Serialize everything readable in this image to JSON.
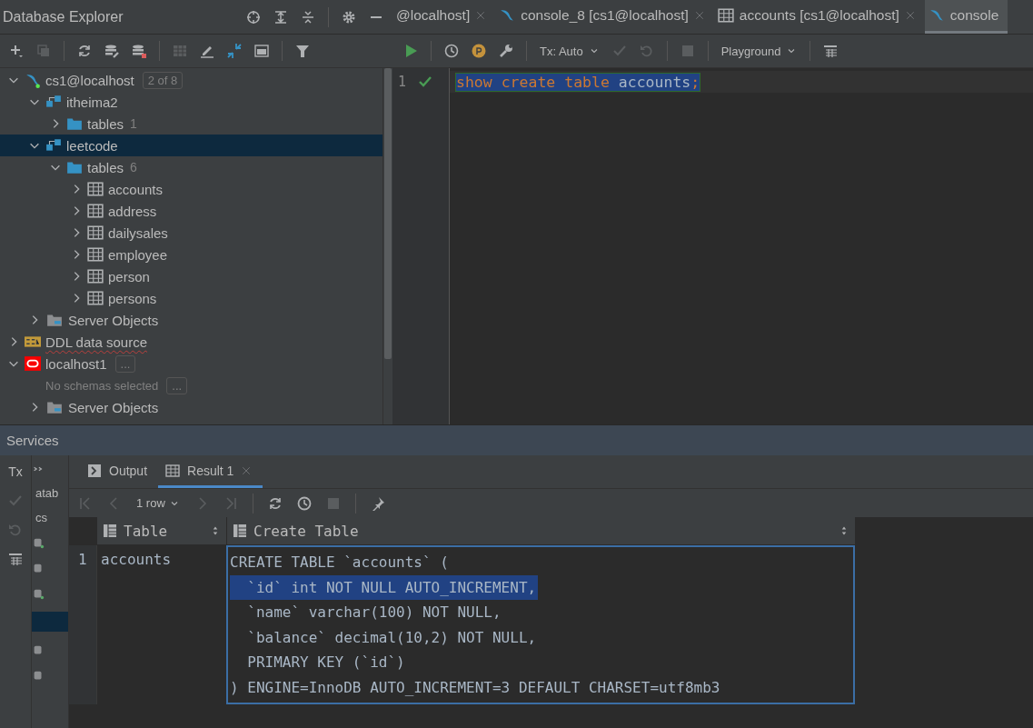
{
  "explorer": {
    "title": "Database Explorer",
    "tree": [
      {
        "label": "cs1@localhost",
        "kind": "connection",
        "expanded": true,
        "badge": "2 of 8",
        "selected": false,
        "children": [
          {
            "label": "itheima2",
            "kind": "schema",
            "expanded": true,
            "selected": false,
            "children": [
              {
                "label": "tables",
                "kind": "folder",
                "expanded": false,
                "count": "1",
                "selected": false
              }
            ]
          },
          {
            "label": "leetcode",
            "kind": "schema",
            "expanded": true,
            "selected": true,
            "children": [
              {
                "label": "tables",
                "kind": "folder",
                "expanded": true,
                "count": "6",
                "selected": false,
                "children": [
                  {
                    "label": "accounts",
                    "kind": "table",
                    "expanded": false,
                    "selected": false
                  },
                  {
                    "label": "address",
                    "kind": "table",
                    "expanded": false,
                    "selected": false
                  },
                  {
                    "label": "dailysales",
                    "kind": "table",
                    "expanded": false,
                    "selected": false
                  },
                  {
                    "label": "employee",
                    "kind": "table",
                    "expanded": false,
                    "selected": false
                  },
                  {
                    "label": "person",
                    "kind": "table",
                    "expanded": false,
                    "selected": false
                  },
                  {
                    "label": "persons",
                    "kind": "table",
                    "expanded": false,
                    "selected": false
                  }
                ]
              }
            ]
          },
          {
            "label": "Server Objects",
            "kind": "server",
            "expanded": false,
            "selected": false
          }
        ]
      },
      {
        "label": "DDL data source",
        "kind": "ddl",
        "expanded": false,
        "spell_error": true,
        "selected": false
      },
      {
        "label": "localhost1",
        "kind": "oracle",
        "expanded": true,
        "badge": "...",
        "selected": false,
        "children": [
          {
            "label": "No schemas selected",
            "kind": "note",
            "badge": "...",
            "selected": false
          },
          {
            "label": "Server Objects",
            "kind": "server",
            "expanded": false,
            "selected": false
          }
        ]
      }
    ]
  },
  "editor_tabs": [
    {
      "label": "@localhost]",
      "kind": "plain",
      "selected": false
    },
    {
      "label": "console_8 [cs1@localhost]",
      "kind": "console",
      "selected": false
    },
    {
      "label": "accounts [cs1@localhost]",
      "kind": "table",
      "selected": false
    },
    {
      "label": "console",
      "kind": "console",
      "selected": true
    }
  ],
  "editor_toolbar": {
    "tx_mode": "Tx: Auto",
    "session_mode": "Playground"
  },
  "editor": {
    "lines": [
      {
        "number": "1",
        "ok": true,
        "selected": true,
        "tokens": [
          {
            "text": "show create table ",
            "kind": "keyword"
          },
          {
            "text": "accounts",
            "kind": "ident"
          },
          {
            "text": ";",
            "kind": "punct"
          }
        ]
      }
    ]
  },
  "services": {
    "title": "Services",
    "side_label": "Tx",
    "tree_texts": [
      "atab",
      "cs"
    ],
    "tabs": [
      {
        "label": "Output",
        "kind": "output",
        "selected": false,
        "closable": false
      },
      {
        "label": "Result 1",
        "kind": "grid",
        "selected": true,
        "closable": true
      }
    ],
    "pager": "1 row",
    "grid": {
      "columns": [
        {
          "label": "Table"
        },
        {
          "label": "Create Table"
        }
      ],
      "rows": [
        {
          "number": "1",
          "table": "accounts",
          "create_lines": [
            {
              "text": "CREATE TABLE `accounts` (",
              "selected": false
            },
            {
              "text": "  `id` int NOT NULL AUTO_INCREMENT,",
              "selected": true
            },
            {
              "text": "  `name` varchar(100) NOT NULL,",
              "selected": false
            },
            {
              "text": "  `balance` decimal(10,2) NOT NULL,",
              "selected": false
            },
            {
              "text": "  PRIMARY KEY (`id`)",
              "selected": false
            },
            {
              "text": ") ENGINE=InnoDB AUTO_INCREMENT=3 DEFAULT CHARSET=utf8mb3",
              "selected": false
            }
          ]
        }
      ]
    }
  }
}
